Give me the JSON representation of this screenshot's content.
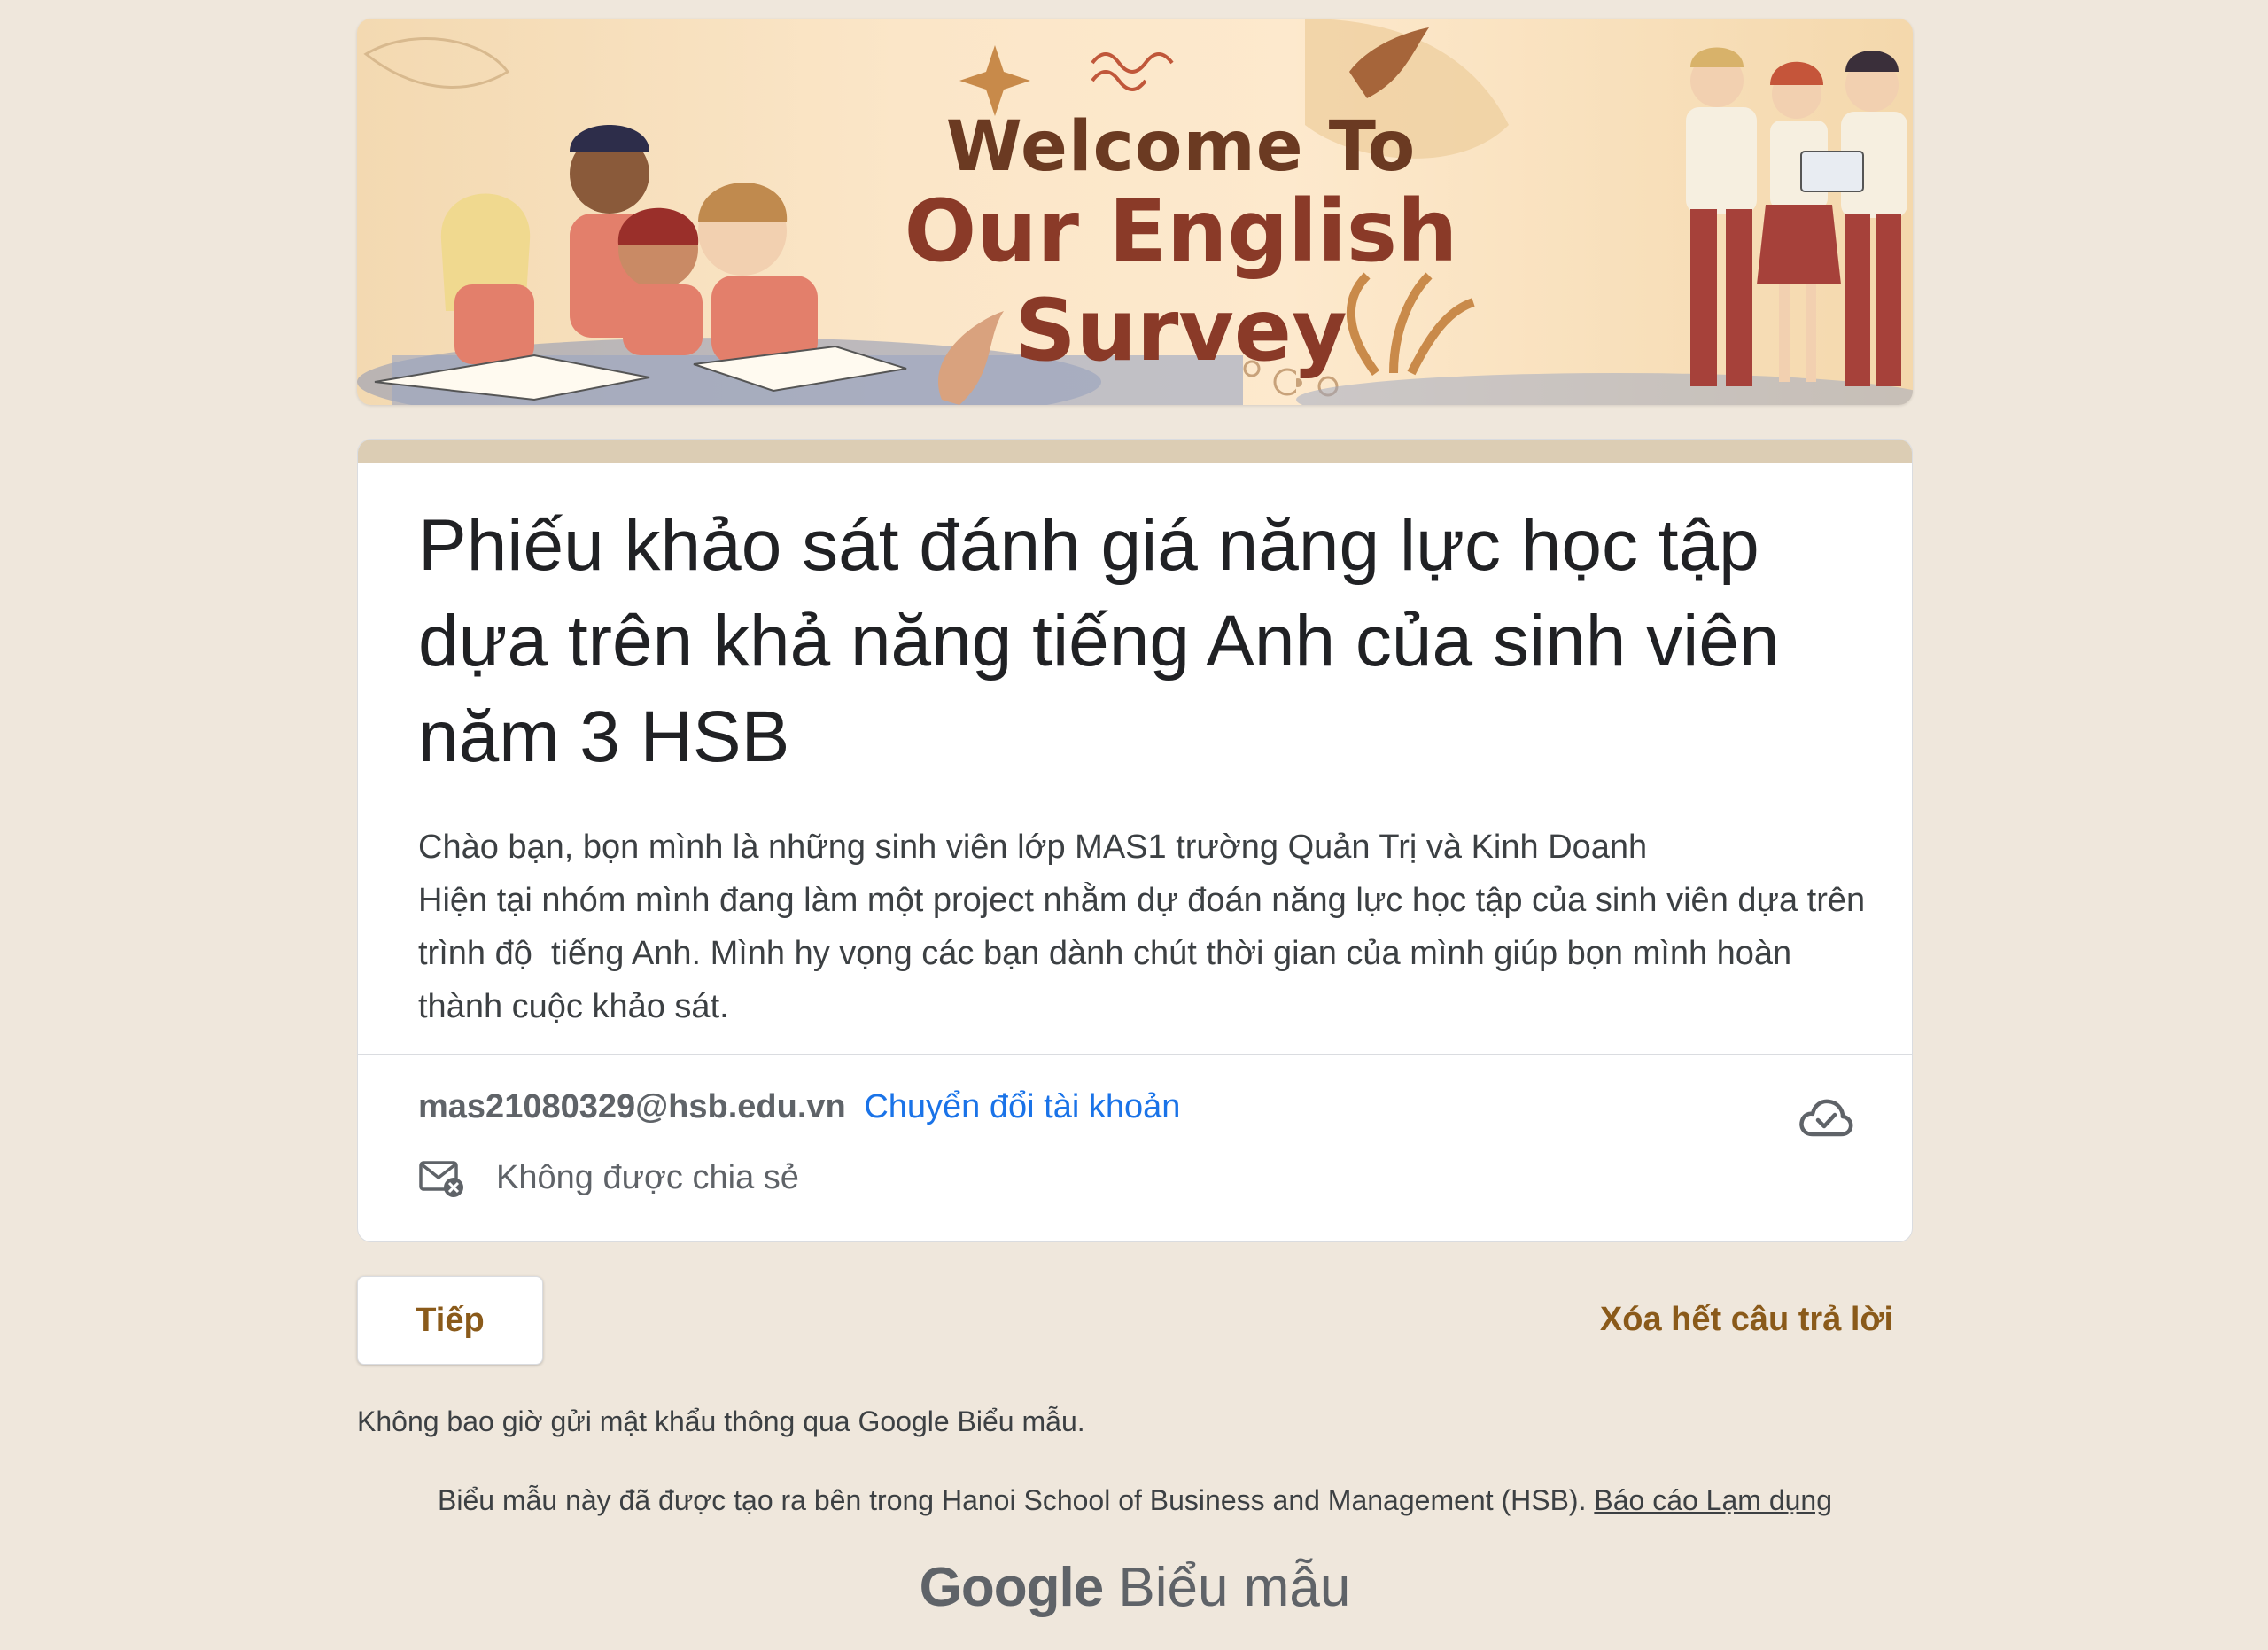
{
  "banner": {
    "line1": "Welcome To",
    "line2": "Our English Survey"
  },
  "form": {
    "title": "Phiếu khảo sát đánh giá năng lực học tập dựa trên khả năng tiếng Anh của sinh viên năm 3 HSB",
    "description_line1": "Chào bạn, bọn mình là những sinh viên lớp MAS1 trường Quản Trị và Kinh Doanh",
    "description_line2": "Hiện tại nhóm mình đang làm một project nhằm dự đoán năng lực học tập của sinh viên dựa trên trình độ  tiếng Anh. Mình hy vọng các bạn dành chút thời gian của mình giúp bọn mình hoàn thành cuộc khảo sát."
  },
  "account": {
    "email": "mas21080329@hsb.edu.vn",
    "switch_label": "Chuyển đổi tài khoản",
    "not_shared_label": "Không được chia sẻ"
  },
  "icons": {
    "not_shared": "mail-block-icon",
    "cloud": "cloud-saved-icon"
  },
  "actions": {
    "next_label": "Tiếp",
    "clear_label": "Xóa hết câu trả lời"
  },
  "footer": {
    "password_warning": "Không bao giờ gửi mật khẩu thông qua Google Biểu mẫu.",
    "created_in": "Biểu mẫu này đã được tạo ra bên trong Hanoi School of Business and Management (HSB).",
    "report_abuse": "Báo cáo Lạm dụng",
    "logo_google": "Google",
    "logo_product": "Biểu mẫu"
  },
  "colors": {
    "background": "#efe7dc",
    "accent": "#8a5a1a",
    "link": "#1a73e8",
    "header_bar": "#dccdb4"
  }
}
